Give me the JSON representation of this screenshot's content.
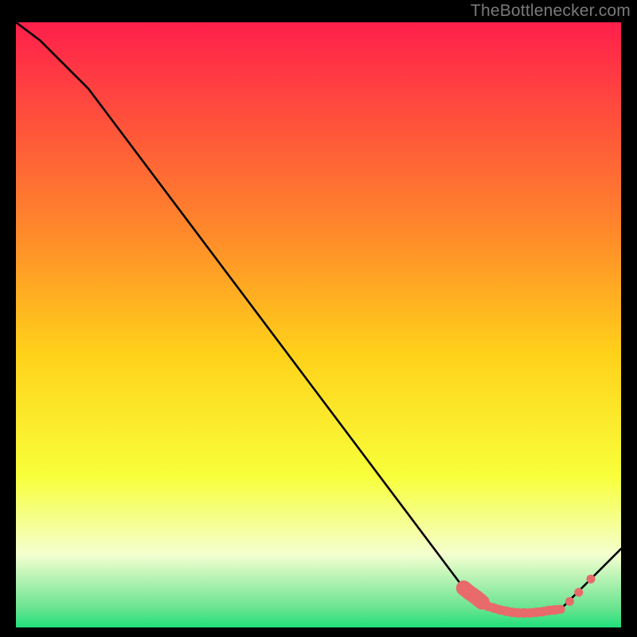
{
  "watermark": "TheBottlenecker.com",
  "colors": {
    "bg_black": "#000000",
    "grad_top": "#ff1f4b",
    "grad_mid1": "#ff6a2a",
    "grad_mid2": "#ffc21a",
    "grad_mid3": "#f8ff3a",
    "grad_pale": "#f4ffd0",
    "grad_green": "#1fe07a",
    "line": "#000000",
    "marker": "#e86a6a"
  },
  "chart_data": {
    "type": "line",
    "title": "",
    "xlabel": "",
    "ylabel": "",
    "xlim": [
      0,
      100
    ],
    "ylim": [
      0,
      100
    ],
    "series": [
      {
        "name": "curve",
        "x": [
          0,
          4,
          8,
          12,
          74,
          78,
          82,
          86,
          90,
          100
        ],
        "y": [
          100,
          97,
          93,
          89,
          6.5,
          3.5,
          2.5,
          2.5,
          3.0,
          13
        ]
      }
    ],
    "markers": {
      "name": "highlight-points",
      "x": [
        74,
        75,
        76,
        77,
        78,
        79,
        80,
        81,
        82,
        83,
        84,
        85,
        86,
        87,
        88,
        89,
        90,
        91.5,
        93,
        95
      ],
      "y": [
        6.5,
        5.7,
        5.0,
        4.2,
        3.5,
        3.2,
        2.9,
        2.7,
        2.5,
        2.4,
        2.4,
        2.4,
        2.5,
        2.6,
        2.8,
        2.9,
        3.0,
        4.3,
        5.8,
        8.0
      ],
      "size_profile": "thick-left-taper"
    },
    "background": {
      "type": "vertical-gradient",
      "stops": [
        {
          "pos": 0.0,
          "color": "#ff1f4b"
        },
        {
          "pos": 0.35,
          "color": "#ff8a2a"
        },
        {
          "pos": 0.55,
          "color": "#ffd21a"
        },
        {
          "pos": 0.75,
          "color": "#f8ff3a"
        },
        {
          "pos": 0.88,
          "color": "#f4ffd0"
        },
        {
          "pos": 0.97,
          "color": "#66e38f"
        },
        {
          "pos": 1.0,
          "color": "#1fe07a"
        }
      ]
    }
  }
}
